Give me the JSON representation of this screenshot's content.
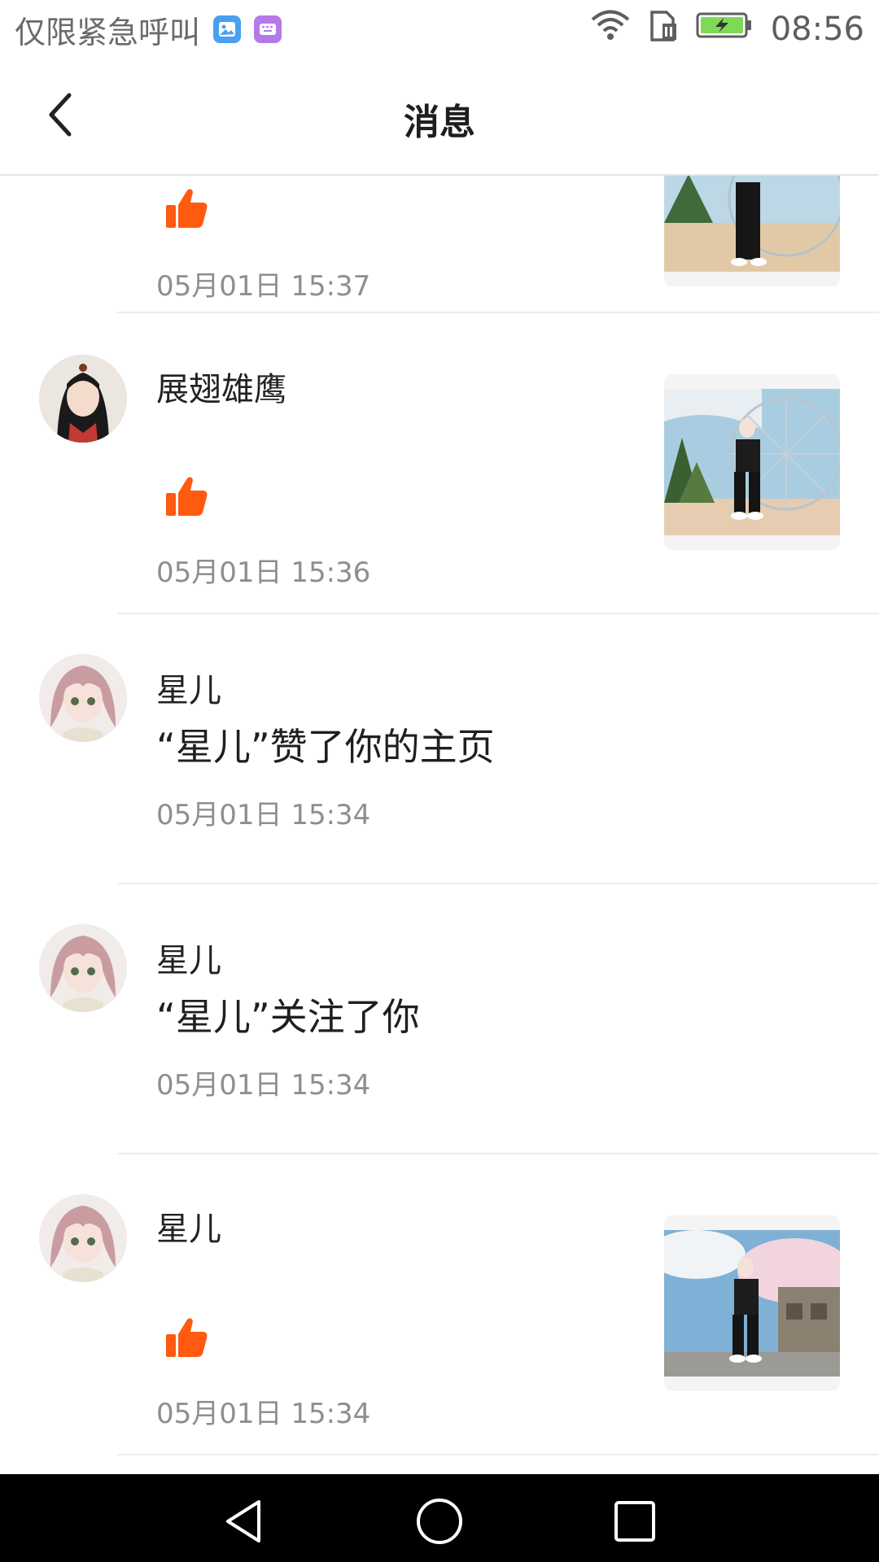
{
  "status_bar": {
    "carrier_text": "仅限紧急呼叫",
    "time": "08:56",
    "icons": [
      "gallery-app-icon",
      "keyboard-app-icon",
      "wifi-icon",
      "sim-icon",
      "battery-charging-icon"
    ],
    "battery_color": "#7ed957"
  },
  "header": {
    "title": "消息",
    "back_icon": "chevron-left-icon"
  },
  "theme": {
    "like_color": "#ff5a10"
  },
  "messages": [
    {
      "name": "",
      "text": "",
      "type": "like",
      "time": "05月01日 15:37",
      "has_thumbnail": true
    },
    {
      "name": "展翅雄鹰",
      "text": "",
      "type": "like",
      "time": "05月01日 15:36",
      "has_thumbnail": true
    },
    {
      "name": "星儿",
      "text": "“星儿”赞了你的主页",
      "type": "text",
      "time": "05月01日 15:34",
      "has_thumbnail": false
    },
    {
      "name": "星儿",
      "text": "“星儿”关注了你",
      "type": "text",
      "time": "05月01日 15:34",
      "has_thumbnail": false
    },
    {
      "name": "星儿",
      "text": "",
      "type": "like",
      "time": "05月01日 15:34",
      "has_thumbnail": true
    }
  ],
  "nav_bar": {
    "icons": [
      "back-triangle-icon",
      "home-circle-icon",
      "recents-square-icon"
    ]
  }
}
